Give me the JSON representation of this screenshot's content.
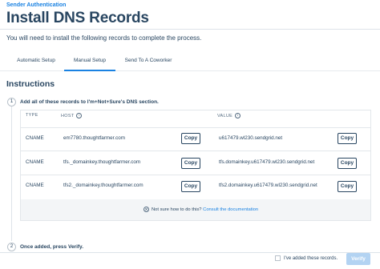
{
  "header": {
    "eyebrow": "Sender Authentication",
    "title": "Install DNS Records",
    "subtitle": "You will need to install the following records to complete the process."
  },
  "tabs": [
    {
      "label": "Automatic Setup",
      "active": false
    },
    {
      "label": "Manual Setup",
      "active": true
    },
    {
      "label": "Send To A Coworker",
      "active": false
    }
  ],
  "instructions": {
    "title": "Instructions",
    "step1": {
      "number": "1",
      "text": "Add all of these records to I'm+Not+Sure's DNS section."
    },
    "step2": {
      "number": "2",
      "text": "Once added, press Verify."
    }
  },
  "table": {
    "headers": {
      "type": "TYPE",
      "host": "HOST",
      "value": "VALUE"
    },
    "copy_label": "Copy",
    "rows": [
      {
        "type": "CNAME",
        "host": "em7780.thoughtfarmer.com",
        "value": "u617479.wl230.sendgrid.net"
      },
      {
        "type": "CNAME",
        "host": "tfs._domainkey.thoughtfarmer.com",
        "value": "tfs.domainkey.u617479.wl230.sendgrid.net"
      },
      {
        "type": "CNAME",
        "host": "tfs2._domainkey.thoughtfarmer.com",
        "value": "tfs2.domainkey.u617479.wl230.sendgrid.net"
      }
    ]
  },
  "help": {
    "text": "Not sure how to do this?",
    "link": "Consult the documentation"
  },
  "footer": {
    "checkbox_label": "I've added these records.",
    "verify_label": "Verify"
  },
  "colors": {
    "accent": "#1a82e2",
    "text": "#294661",
    "verify_disabled": "#b3d3f2"
  }
}
